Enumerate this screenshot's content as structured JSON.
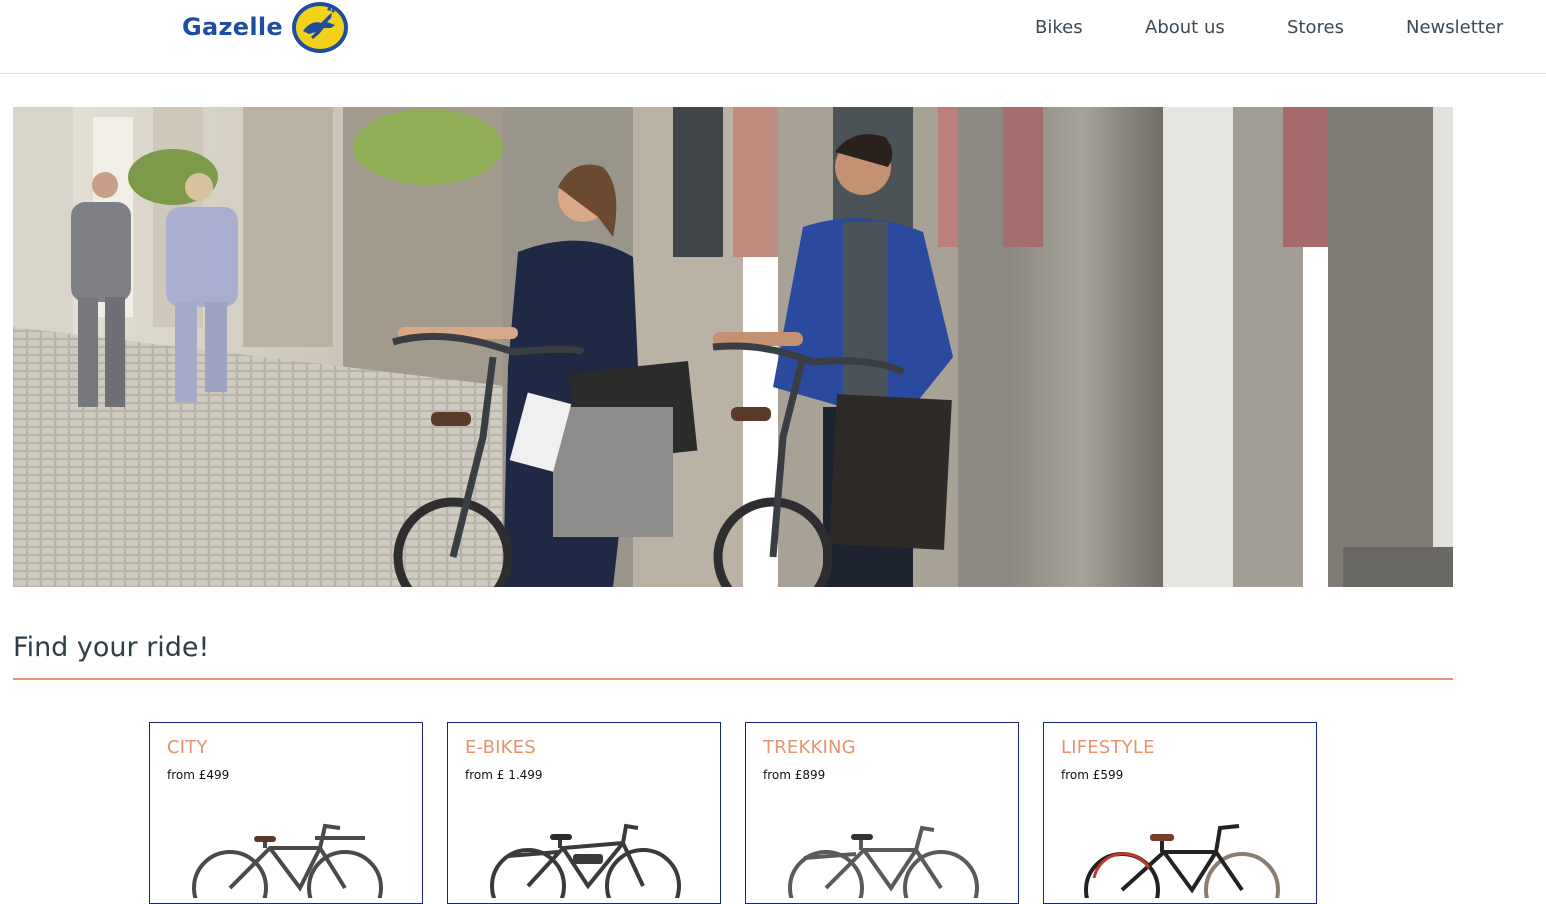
{
  "header": {
    "brand": "Gazelle",
    "nav": [
      "Bikes",
      "About us",
      "Stores",
      "Newsletter"
    ]
  },
  "hero": {
    "image": "photo of a couple walking bicycles with shopping bags down a cobblestone street"
  },
  "section": {
    "title": "Find your ride!"
  },
  "categories": [
    {
      "name": "CITY",
      "price": "from £499",
      "bike_color": "#4a4a4a"
    },
    {
      "name": "E-BIKES",
      "price": "from £ 1.499",
      "bike_color": "#3a3a3a"
    },
    {
      "name": "TREKKING",
      "price": "from £899",
      "bike_color": "#5a5a5a"
    },
    {
      "name": "LIFESTYLE",
      "price": "from £599",
      "bike_color": "#222222"
    }
  ],
  "colors": {
    "brand_blue": "#1f4ea1",
    "brand_yellow": "#f2d21b",
    "accent": "#e8936f",
    "card_border": "#1a237e",
    "nav_text": "#3b4a55"
  }
}
